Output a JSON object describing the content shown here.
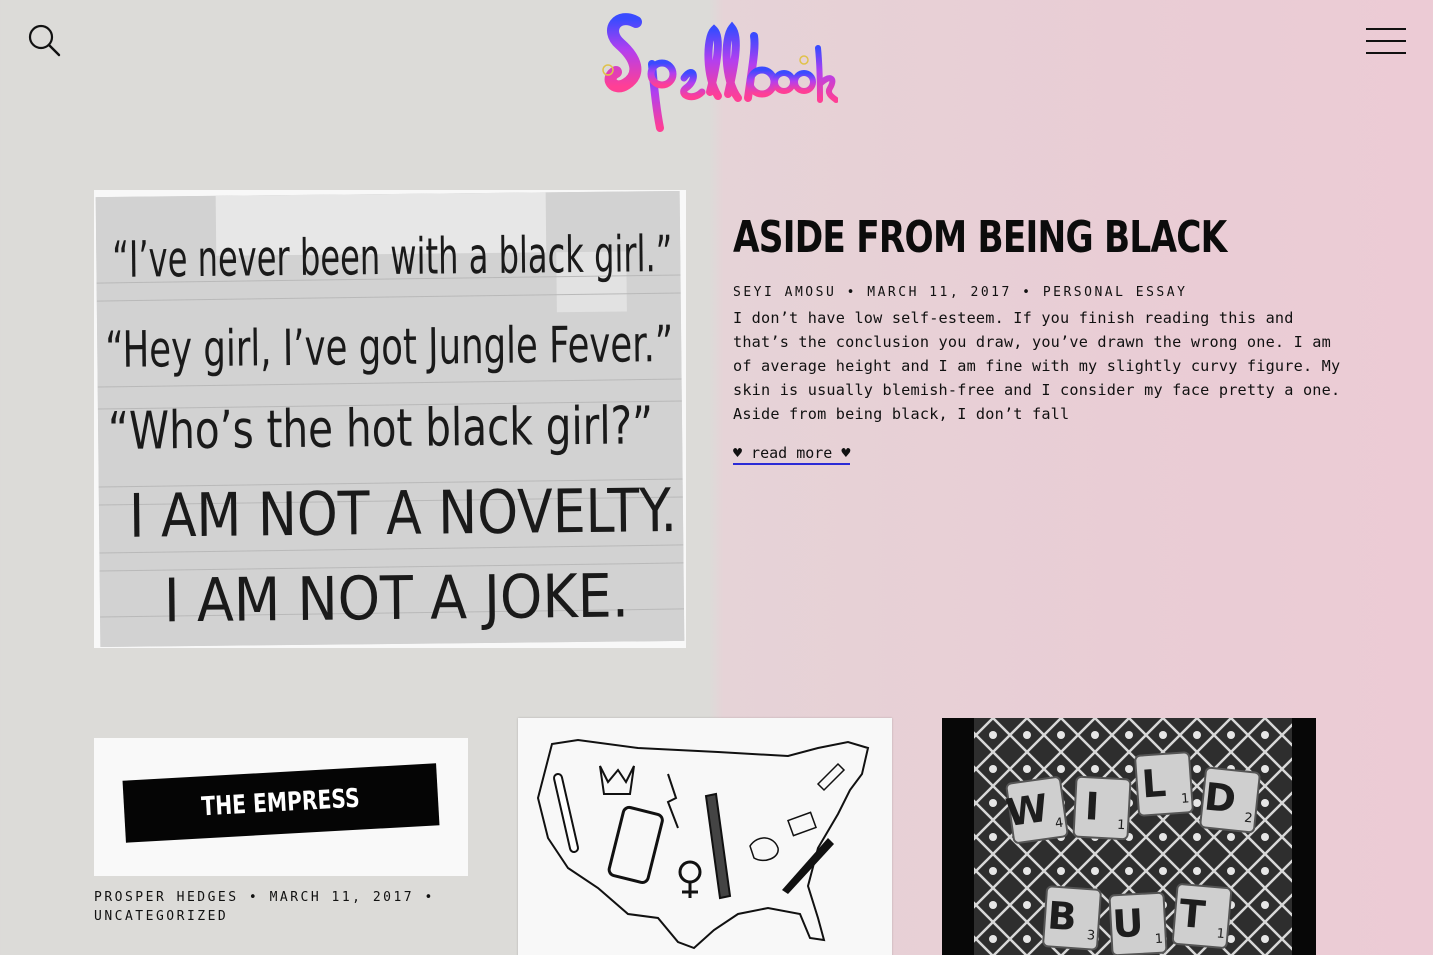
{
  "header": {
    "logo_text": "Spellbook",
    "search_icon": "search-icon",
    "menu_icon": "hamburger-menu-icon"
  },
  "feature": {
    "image_lines": [
      "“I’ve never been with a black girl.”",
      "“Hey girl, I’ve got Jungle Fever.”",
      "“Who’s the hot black girl?”",
      "I AM NOT A NOVELTY.",
      "I AM NOT A JOKE."
    ],
    "title": "ASIDE FROM BEING BLACK",
    "author": "SEYI AMOSU",
    "date": "MARCH 11, 2017",
    "category": "PERSONAL ESSAY",
    "separator": "•",
    "excerpt": "I don’t have low self-esteem. If you finish reading this and that’s the conclusion you draw, you’ve drawn the wrong one. I am of average height and I am fine with my slightly curvy figure. My skin is usually blemish-free and I consider my face pretty a one. Aside from being black, I don’t fall",
    "read_more": "♥ read more ♥"
  },
  "cards": [
    {
      "thumb_text": "THE EMPRESS",
      "author": "PROSPER HEDGES",
      "date": "MARCH 11, 2017",
      "category": "UNCATEGORIZED"
    },
    {
      "thumb_description_icon": "us-map-illustration-icon"
    },
    {
      "tiles_row1": [
        [
          "W",
          "4"
        ],
        [
          "I",
          "1"
        ],
        [
          "L",
          "1"
        ],
        [
          "D",
          "2"
        ]
      ],
      "tiles_row2": [
        [
          "B",
          "3"
        ],
        [
          "U",
          "1"
        ],
        [
          "T",
          "1"
        ]
      ]
    }
  ],
  "colors": {
    "left_bg": "#dcdbd8",
    "right_bg": "#e9cdd5",
    "link_underline": "#2b2bd6"
  }
}
